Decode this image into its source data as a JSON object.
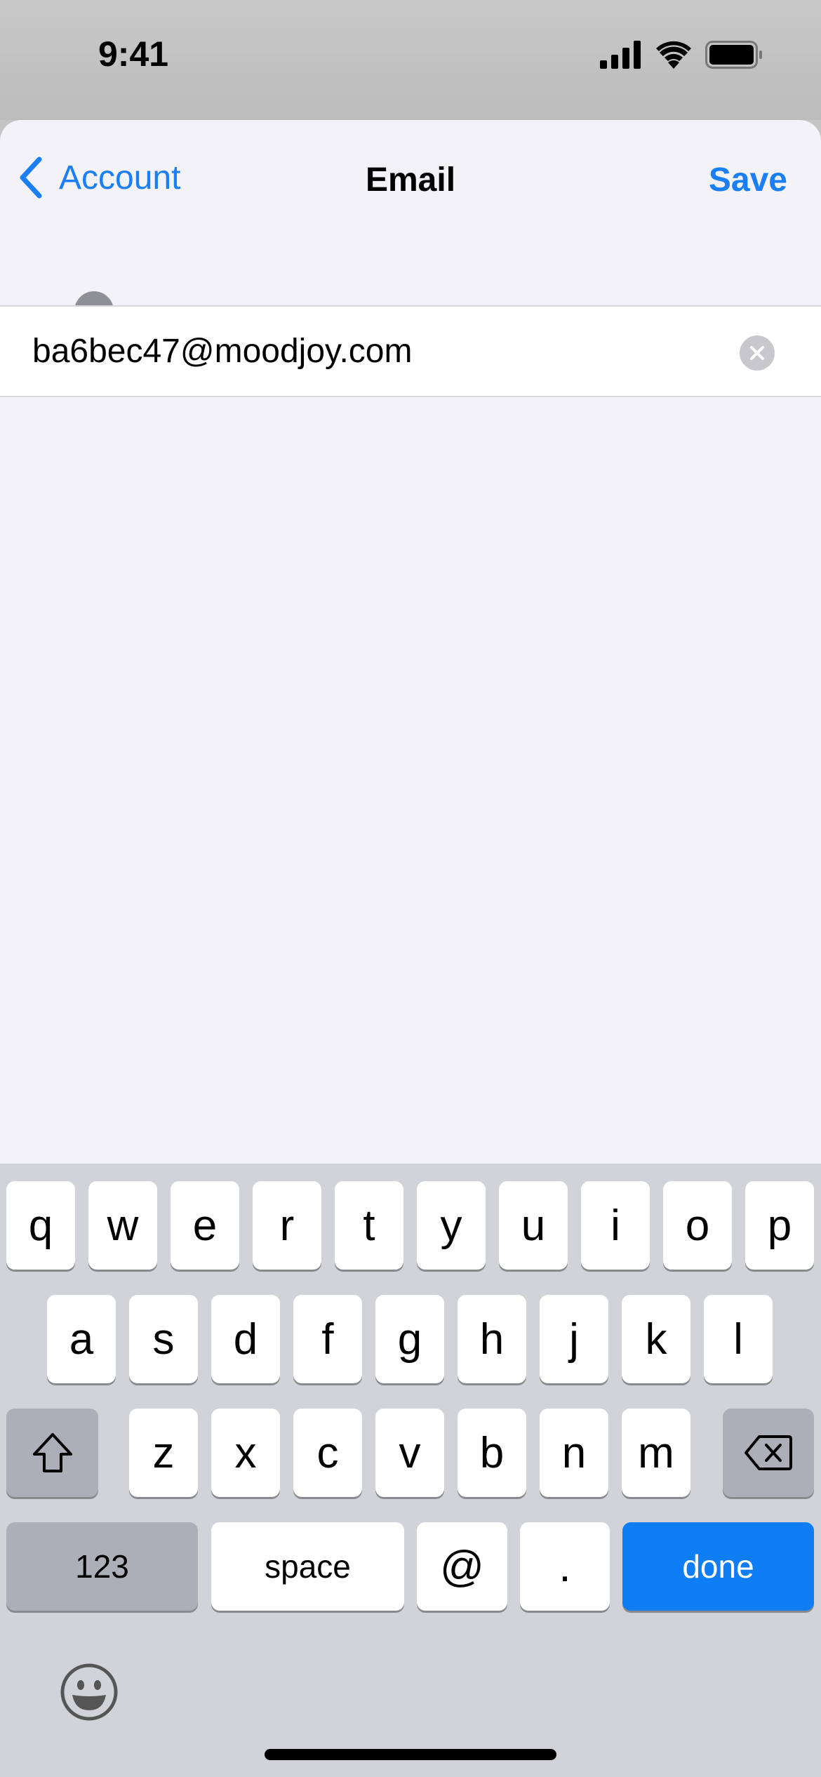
{
  "status_bar": {
    "time": "9:41",
    "icons": [
      "cellular-signal-icon",
      "wifi-icon",
      "battery-icon"
    ]
  },
  "nav": {
    "back_label": "Account",
    "title": "Email",
    "save_label": "Save"
  },
  "email_field": {
    "value": "ba6bec47@moodjoy.com"
  },
  "keyboard": {
    "row1": [
      "q",
      "w",
      "e",
      "r",
      "t",
      "y",
      "u",
      "i",
      "o",
      "p"
    ],
    "row2": [
      "a",
      "s",
      "d",
      "f",
      "g",
      "h",
      "j",
      "k",
      "l"
    ],
    "row3": [
      "z",
      "x",
      "c",
      "v",
      "b",
      "n",
      "m"
    ],
    "numbers_label": "123",
    "space_label": "space",
    "at_label": "@",
    "dot_label": ".",
    "done_label": "done"
  },
  "colors": {
    "accent": "#1a7ef5",
    "done_key": "#0f7ef5",
    "background": "#f2f2f7"
  }
}
